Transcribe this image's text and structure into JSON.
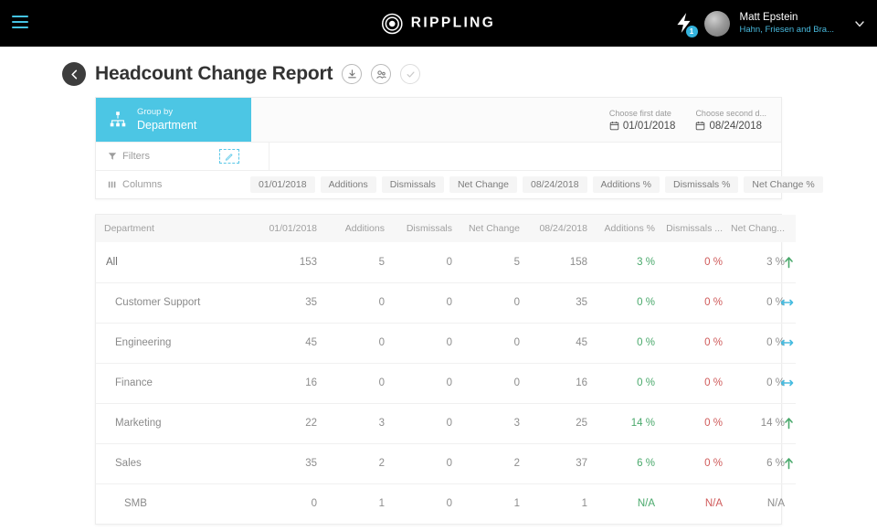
{
  "topnav": {
    "menu_icon": "hamburger-icon",
    "brand": "RIPPLING",
    "brand_logo_icon": "rippling-rings-icon",
    "bolt_icon": "lightning-bolt-icon",
    "bolt_badge": "1",
    "user_name": "Matt Epstein",
    "user_org": "Hahn, Friesen and Bra...",
    "chevron": "⌄"
  },
  "header": {
    "back_icon": "back-arrow-icon",
    "title": "Headcount Change Report",
    "actions": [
      {
        "name": "download-icon"
      },
      {
        "name": "share-people-icon"
      },
      {
        "name": "check-icon"
      }
    ]
  },
  "controls": {
    "group_by_label": "Group by",
    "group_by_value": "Department",
    "group_by_icon": "org-chart-icon",
    "first_date_label": "Choose first date",
    "first_date_value": "01/01/2018",
    "second_date_label": "Choose second d...",
    "second_date_value": "08/24/2018",
    "calendar_icon": "calendar-icon",
    "filters_label": "Filters",
    "filters_icon": "funnel-icon",
    "filters_edit_icon": "pencil-icon",
    "columns_label": "Columns",
    "columns_icon": "columns-icon",
    "column_chips": [
      "01/01/2018",
      "Additions",
      "Dismissals",
      "Net Change",
      "08/24/2018",
      "Additions %",
      "Dismissals %",
      "Net Change %"
    ]
  },
  "table": {
    "headers": [
      "Department",
      "01/01/2018",
      "Additions",
      "Dismissals",
      "Net Change",
      "08/24/2018",
      "Additions %",
      "Dismissals ...",
      "Net Chang..."
    ],
    "rows": [
      {
        "department": "All",
        "level": 0,
        "start": "153",
        "additions": "5",
        "dismissals": "0",
        "net_change": "5",
        "end": "158",
        "additions_pct": "3 %",
        "dismissals_pct": "0 %",
        "net_change_pct": "3 %",
        "trend": "up"
      },
      {
        "department": "Customer Support",
        "level": 1,
        "start": "35",
        "additions": "0",
        "dismissals": "0",
        "net_change": "0",
        "end": "35",
        "additions_pct": "0 %",
        "dismissals_pct": "0 %",
        "net_change_pct": "0 %",
        "trend": "flat"
      },
      {
        "department": "Engineering",
        "level": 1,
        "start": "45",
        "additions": "0",
        "dismissals": "0",
        "net_change": "0",
        "end": "45",
        "additions_pct": "0 %",
        "dismissals_pct": "0 %",
        "net_change_pct": "0 %",
        "trend": "flat"
      },
      {
        "department": "Finance",
        "level": 1,
        "start": "16",
        "additions": "0",
        "dismissals": "0",
        "net_change": "0",
        "end": "16",
        "additions_pct": "0 %",
        "dismissals_pct": "0 %",
        "net_change_pct": "0 %",
        "trend": "flat"
      },
      {
        "department": "Marketing",
        "level": 1,
        "start": "22",
        "additions": "3",
        "dismissals": "0",
        "net_change": "3",
        "end": "25",
        "additions_pct": "14 %",
        "dismissals_pct": "0 %",
        "net_change_pct": "14 %",
        "trend": "up"
      },
      {
        "department": "Sales",
        "level": 1,
        "start": "35",
        "additions": "2",
        "dismissals": "0",
        "net_change": "2",
        "end": "37",
        "additions_pct": "6 %",
        "dismissals_pct": "0 %",
        "net_change_pct": "6 %",
        "trend": "up"
      },
      {
        "department": "SMB",
        "level": 2,
        "start": "0",
        "additions": "1",
        "dismissals": "0",
        "net_change": "1",
        "end": "1",
        "additions_pct": "N/A",
        "dismissals_pct": "N/A",
        "net_change_pct": "N/A",
        "trend": "none"
      }
    ]
  },
  "colors": {
    "accent_cyan": "#4cc6e4",
    "nav_black": "#000000",
    "positive_green": "#4aa96c",
    "negative_red": "#cf5a5a",
    "flat_blue": "#45bbe0"
  }
}
